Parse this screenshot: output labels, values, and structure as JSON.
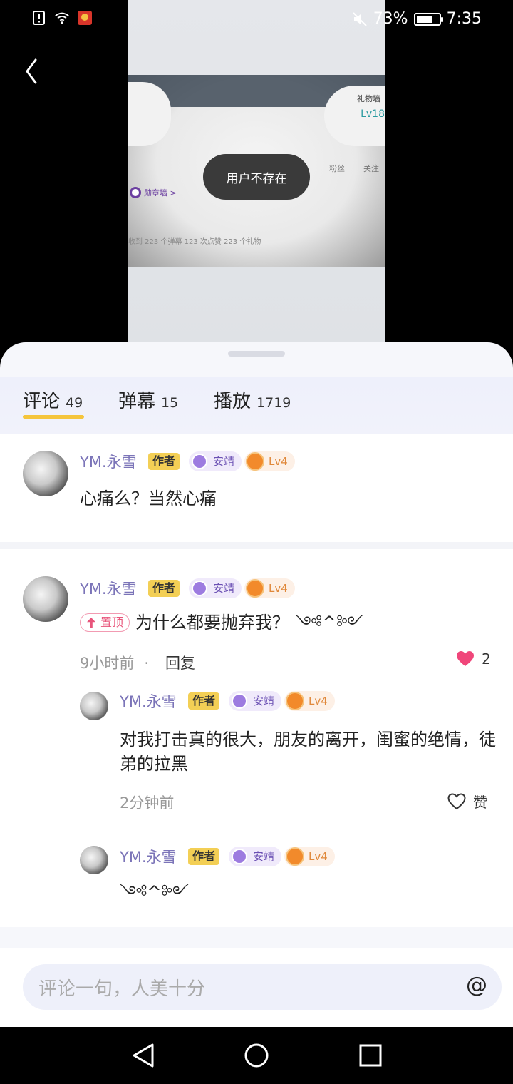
{
  "status_bar": {
    "battery_text": "73%",
    "battery_level": 0.73,
    "time": "7:35"
  },
  "video": {
    "toast": "用户不存在",
    "gift_label": "礼物墙",
    "level": "Lv18",
    "fans_label": "粉丝",
    "follow_label": "关注",
    "medal_label": "勋章墙 >",
    "stats": "收到 223 个弹幕   123 次点赞   223 个礼物"
  },
  "tabs": [
    {
      "label": "评论",
      "count": "49"
    },
    {
      "label": "弹幕",
      "count": "15"
    },
    {
      "label": "播放",
      "count": "1719"
    }
  ],
  "comments": [
    {
      "name": "YM.永雪",
      "author_tag": "作者",
      "badge": "安靖",
      "level": "Lv4",
      "text": "心痛么？当然心痛"
    },
    {
      "name": "YM.永雪",
      "author_tag": "作者",
      "badge": "安靖",
      "level": "Lv4",
      "pin_label": "置顶",
      "text": "为什么都要抛弃我？ ༺^༻",
      "time": "9小时前",
      "reply_label": "回复",
      "likes": "2",
      "replies": [
        {
          "name": "YM.永雪",
          "author_tag": "作者",
          "badge": "安靖",
          "level": "Lv4",
          "text": "对我打击真的很大，朋友的离开，闺蜜的绝情，徒弟的拉黑",
          "time": "2分钟前",
          "like_label": "赞"
        },
        {
          "name": "YM.永雪",
          "author_tag": "作者",
          "badge": "安靖",
          "level": "Lv4",
          "text": "༺^༻"
        }
      ]
    }
  ],
  "input": {
    "placeholder": "评论一句，人美十分",
    "at_symbol": "@"
  },
  "colors": {
    "accent_yellow": "#f5c53c",
    "name_purple": "#7b74b8",
    "like_pink": "#f0467a"
  }
}
